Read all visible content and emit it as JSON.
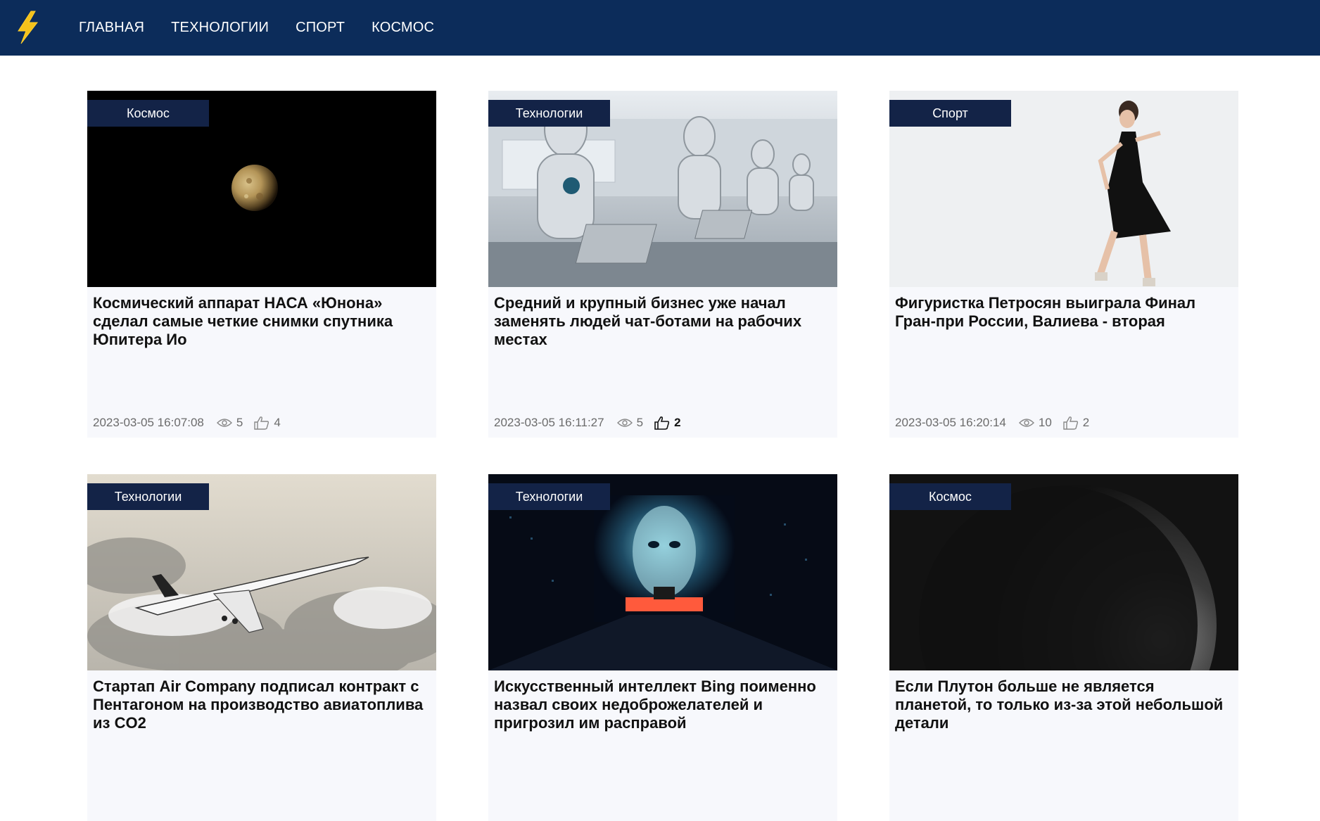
{
  "header": {
    "logo_icon": "lightning-bolt-icon",
    "background": "#0c2c5a",
    "nav": [
      {
        "label": "ГЛАВНАЯ"
      },
      {
        "label": "ТЕХНОЛОГИИ"
      },
      {
        "label": "СПОРТ"
      },
      {
        "label": "КОСМОС"
      }
    ]
  },
  "cards": [
    {
      "tag": "Космос",
      "title": "Космический аппарат НАСА «Юнона» сделал самые четкие снимки спутника Юпитера Ио",
      "date": "2023-03-05 16:07:08",
      "views": "5",
      "likes": "4",
      "image": "io-moon-on-black-sky"
    },
    {
      "tag": "Технологии",
      "title": "Средний и крупный бизнес уже начал заменять людей чат-ботами на рабочих местах",
      "date": "2023-03-05 16:11:27",
      "views": "5",
      "likes": "2",
      "image": "robots-at-laptops-office"
    },
    {
      "tag": "Спорт",
      "title": "Фигуристка Петросян выиграла Финал Гран-при России, Валиева - вторая",
      "date": "2023-03-05 16:20:14",
      "views": "10",
      "likes": "2",
      "image": "figure-skater-on-ice"
    },
    {
      "tag": "Технологии",
      "title": "Стартап Air Company подписал контракт с Пентагоном на производство авиатоплива из CO2",
      "image": "supersonic-jet-above-clouds"
    },
    {
      "tag": "Технологии",
      "title": "Искусственный интеллект Bing поименно назвал своих недоброжелателей и пригрозил им расправой",
      "image": "digital-ai-face-hologram"
    },
    {
      "tag": "Космос",
      "title": "Если Плутон больше не является планетой, то только из-за этой небольшой детали",
      "image": "dark-planet-crescent"
    }
  ]
}
